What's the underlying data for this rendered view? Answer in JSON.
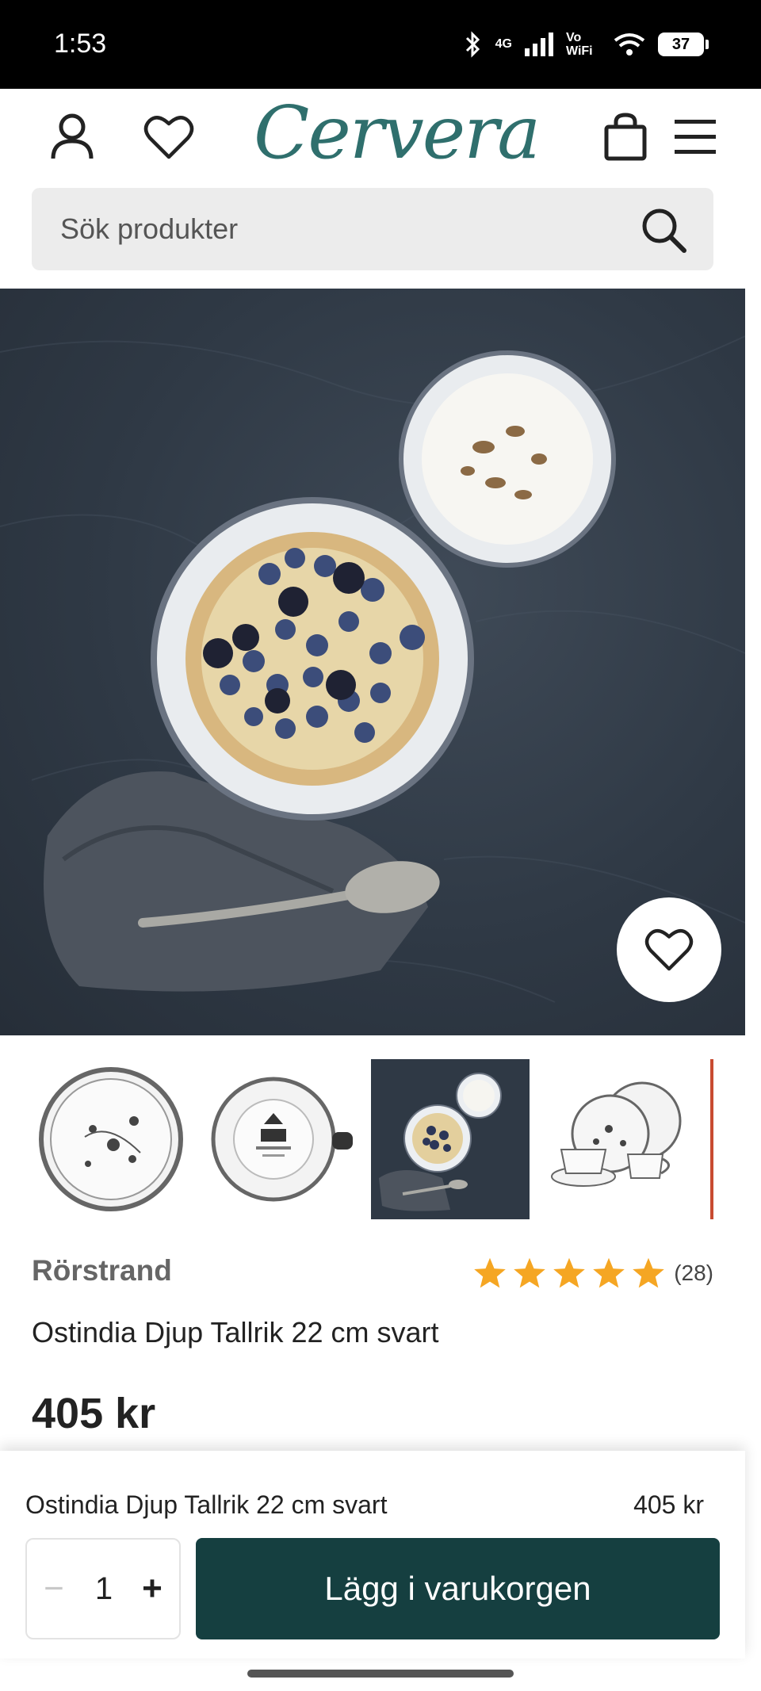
{
  "status_bar": {
    "time": "1:53",
    "network": "4G",
    "wifi_label": "Vo WiFi",
    "battery": "37"
  },
  "header": {
    "logo": "Cervera",
    "brand_color": "#2f6f6d",
    "icons": [
      "account-icon",
      "wishlist-heart-icon",
      "cart-bag-icon",
      "menu-icon"
    ]
  },
  "search": {
    "placeholder": "Sök produkter",
    "icon": "search-icon"
  },
  "hero": {
    "alt_scene": "bowls-with-porridge-and-berries",
    "favorite_icon": "heart-icon"
  },
  "thumbnails": [
    {
      "name": "thumb-plate-floral"
    },
    {
      "name": "thumb-plate-back"
    },
    {
      "name": "thumb-lifestyle",
      "selected": true
    },
    {
      "name": "thumb-set"
    }
  ],
  "product": {
    "brand": "Rörstrand",
    "rating_stars": 5,
    "rating_count": "(28)",
    "title": "Ostindia Djup Tallrik 22 cm svart",
    "price": "405 kr",
    "star_color": "#f5a623"
  },
  "sticky_bar": {
    "title": "Ostindia Djup Tallrik 22 cm svart",
    "price": "405 kr",
    "qty_minus": "−",
    "qty_value": "1",
    "qty_plus": "+",
    "add_to_cart": "Lägg i varukorgen",
    "button_color": "#153f40"
  }
}
